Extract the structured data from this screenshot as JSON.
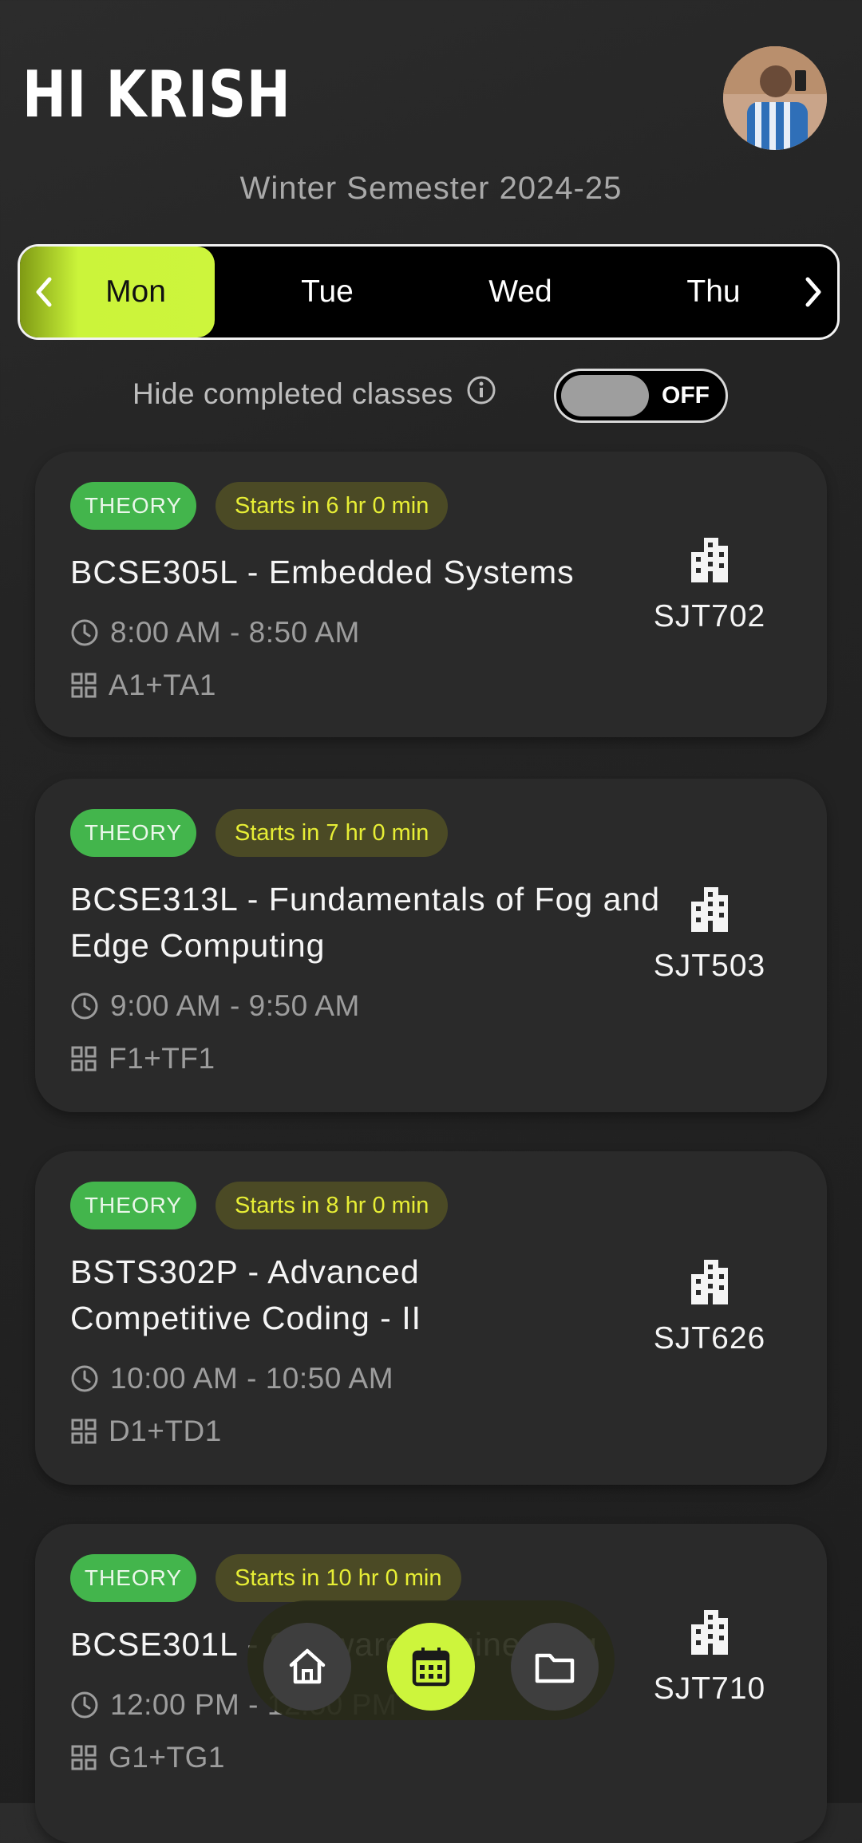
{
  "header": {
    "greeting": "HI KRISH",
    "semester": "Winter Semester 2024-25"
  },
  "days": {
    "items": [
      "Mon",
      "Tue",
      "Wed",
      "Thu"
    ],
    "active": "Mon",
    "accent": "#cdf53c"
  },
  "filter": {
    "label": "Hide completed classes",
    "toggle_state": "OFF"
  },
  "classes": [
    {
      "type": "THEORY",
      "starts": "Starts in 6 hr 0 min",
      "title": "BCSE305L - Embedded Systems",
      "time": "8:00 AM - 8:50 AM",
      "slot": "A1+TA1",
      "room": "SJT702"
    },
    {
      "type": "THEORY",
      "starts": "Starts in 7 hr 0 min",
      "title": "BCSE313L - Fundamentals of Fog and Edge Computing",
      "time": "9:00 AM - 9:50 AM",
      "slot": "F1+TF1",
      "room": "SJT503"
    },
    {
      "type": "THEORY",
      "starts": "Starts in 8 hr 0 min",
      "title": "BSTS302P - Advanced Competitive Coding - II",
      "time": "10:00 AM - 10:50 AM",
      "slot": "D1+TD1",
      "room": "SJT626"
    },
    {
      "type": "THEORY",
      "starts": "Starts in 10 hr 0 min",
      "title": "BCSE301L - Software Engineering",
      "time": "12:00 PM - 12:50 PM",
      "slot": "G1+TG1",
      "room": "SJT710"
    }
  ],
  "colors": {
    "theory_badge": "#43b54c",
    "time_badge_bg": "#4b4a25",
    "time_badge_text": "#e7ee35"
  },
  "nav": {
    "items": [
      "home-icon",
      "calendar-icon",
      "folder-icon"
    ],
    "active": "calendar-icon"
  }
}
